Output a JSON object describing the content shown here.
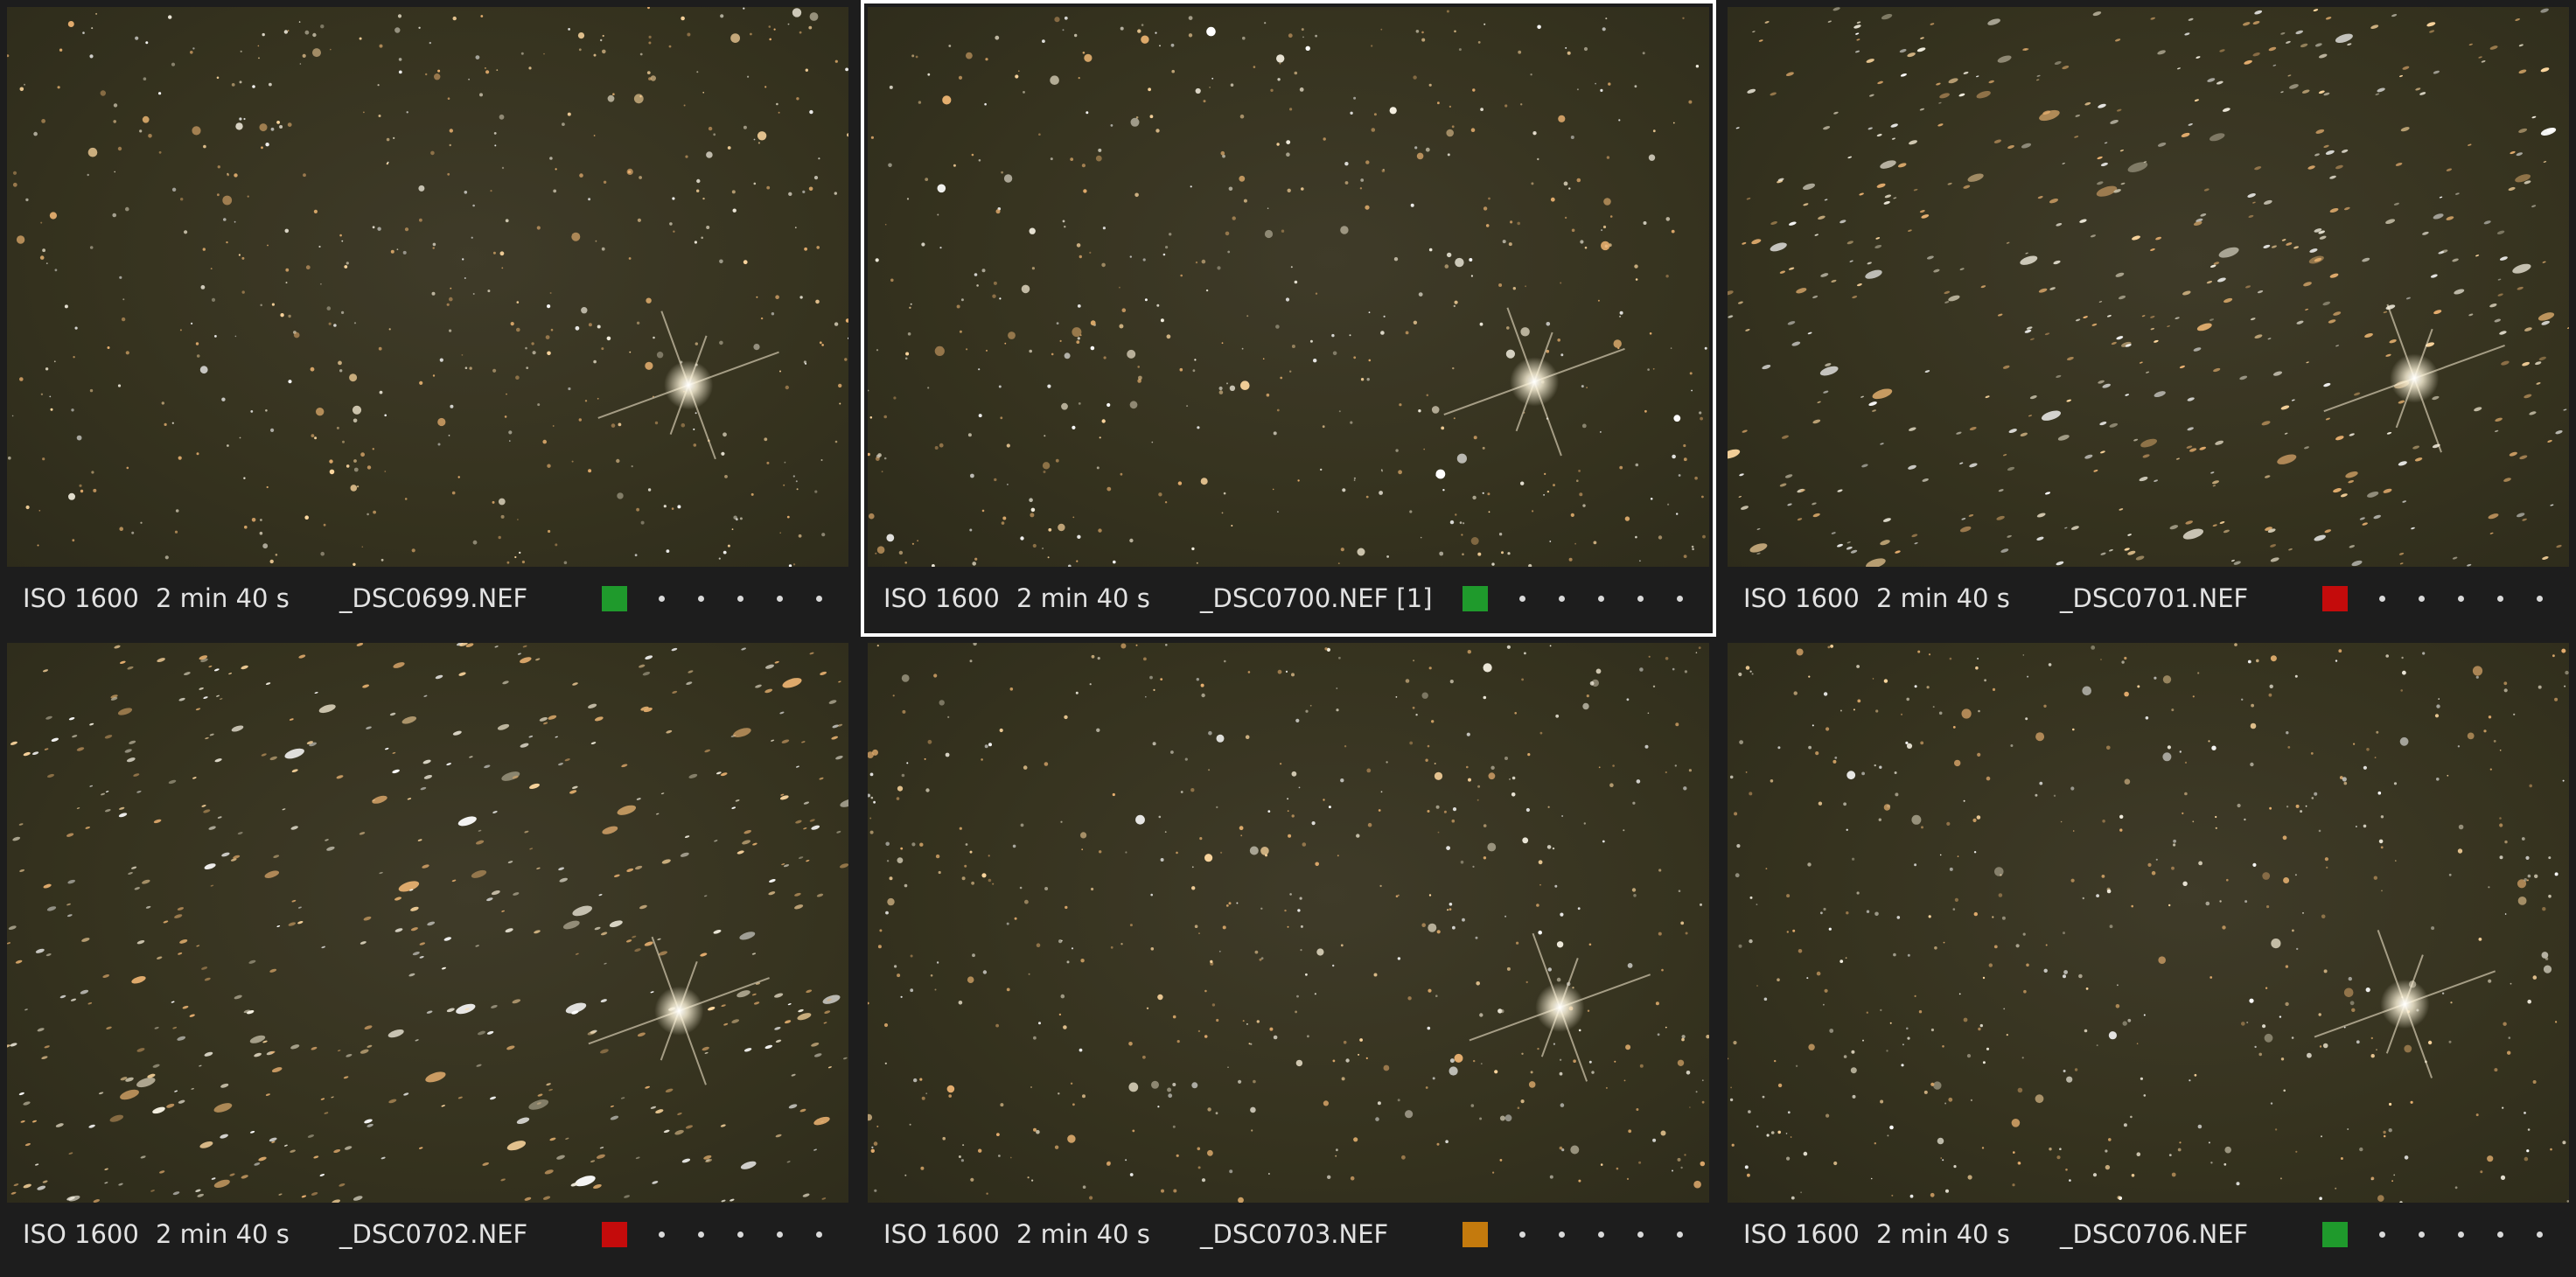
{
  "images": [
    {
      "iso": "ISO 1600",
      "exposure": "2 min 40 s",
      "filename": "_DSC0699.NEF",
      "color_label": "#1f9a2c",
      "color_label_name": "green",
      "rating_dots": 5,
      "selected": false
    },
    {
      "iso": "ISO 1600",
      "exposure": "2 min 40 s",
      "filename": "_DSC0700.NEF [1]",
      "color_label": "#1f9a2c",
      "color_label_name": "green",
      "rating_dots": 5,
      "selected": true
    },
    {
      "iso": "ISO 1600",
      "exposure": "2 min 40 s",
      "filename": "_DSC0701.NEF",
      "color_label": "#c40b0b",
      "color_label_name": "red",
      "rating_dots": 5,
      "selected": false
    },
    {
      "iso": "ISO 1600",
      "exposure": "2 min 40 s",
      "filename": "_DSC0702.NEF",
      "color_label": "#c40b0b",
      "color_label_name": "red",
      "rating_dots": 5,
      "selected": false
    },
    {
      "iso": "ISO 1600",
      "exposure": "2 min 40 s",
      "filename": "_DSC0703.NEF",
      "color_label": "#c47a0d",
      "color_label_name": "orange",
      "rating_dots": 5,
      "selected": false
    },
    {
      "iso": "ISO 1600",
      "exposure": "2 min 40 s",
      "filename": "_DSC0706.NEF",
      "color_label": "#1f9a2c",
      "color_label_name": "green",
      "rating_dots": 5,
      "selected": false
    }
  ]
}
